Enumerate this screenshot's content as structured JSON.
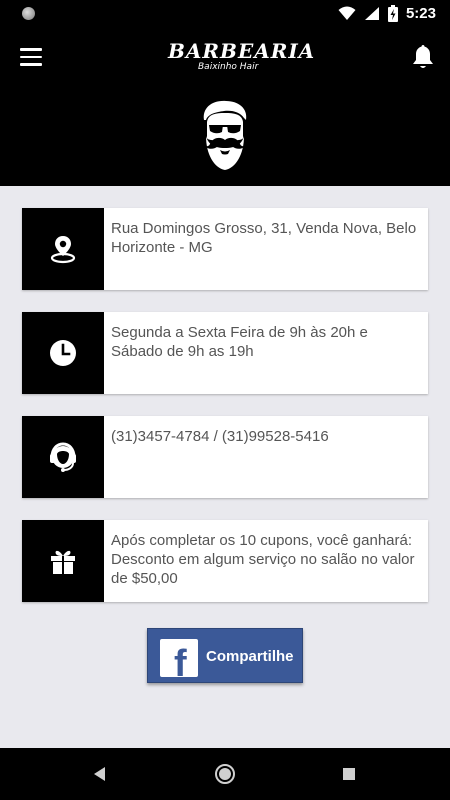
{
  "status_bar": {
    "time": "5:23",
    "icons": [
      "wifi-icon",
      "signal-icon",
      "battery-charging-icon"
    ]
  },
  "header": {
    "brand": "BARBEARIA",
    "brand_sub": "Baixinho Hair",
    "menu_icon": "menu-icon",
    "notification_icon": "bell-icon",
    "mascot_icon": "bearded-man-icon"
  },
  "cards": [
    {
      "icon": "location-pin-icon",
      "text": "Rua Domingos Grosso, 31, Venda Nova, Belo Horizonte - MG"
    },
    {
      "icon": "clock-icon",
      "text": "Segunda a Sexta Feira de 9h às 20h e Sábado de 9h as 19h"
    },
    {
      "icon": "headset-icon",
      "text": "(31)3457-4784 / (31)99528-5416"
    },
    {
      "icon": "gift-icon",
      "text": "Após completar os 10 cupons, você ganhará: Desconto em algum serviço no salão no valor de $50,00"
    }
  ],
  "share_button": {
    "label": "Compartilhe",
    "icon": "facebook-icon",
    "color": "#3b5998"
  },
  "nav_bar": {
    "items": [
      "back-icon",
      "home-icon",
      "recents-icon"
    ]
  }
}
